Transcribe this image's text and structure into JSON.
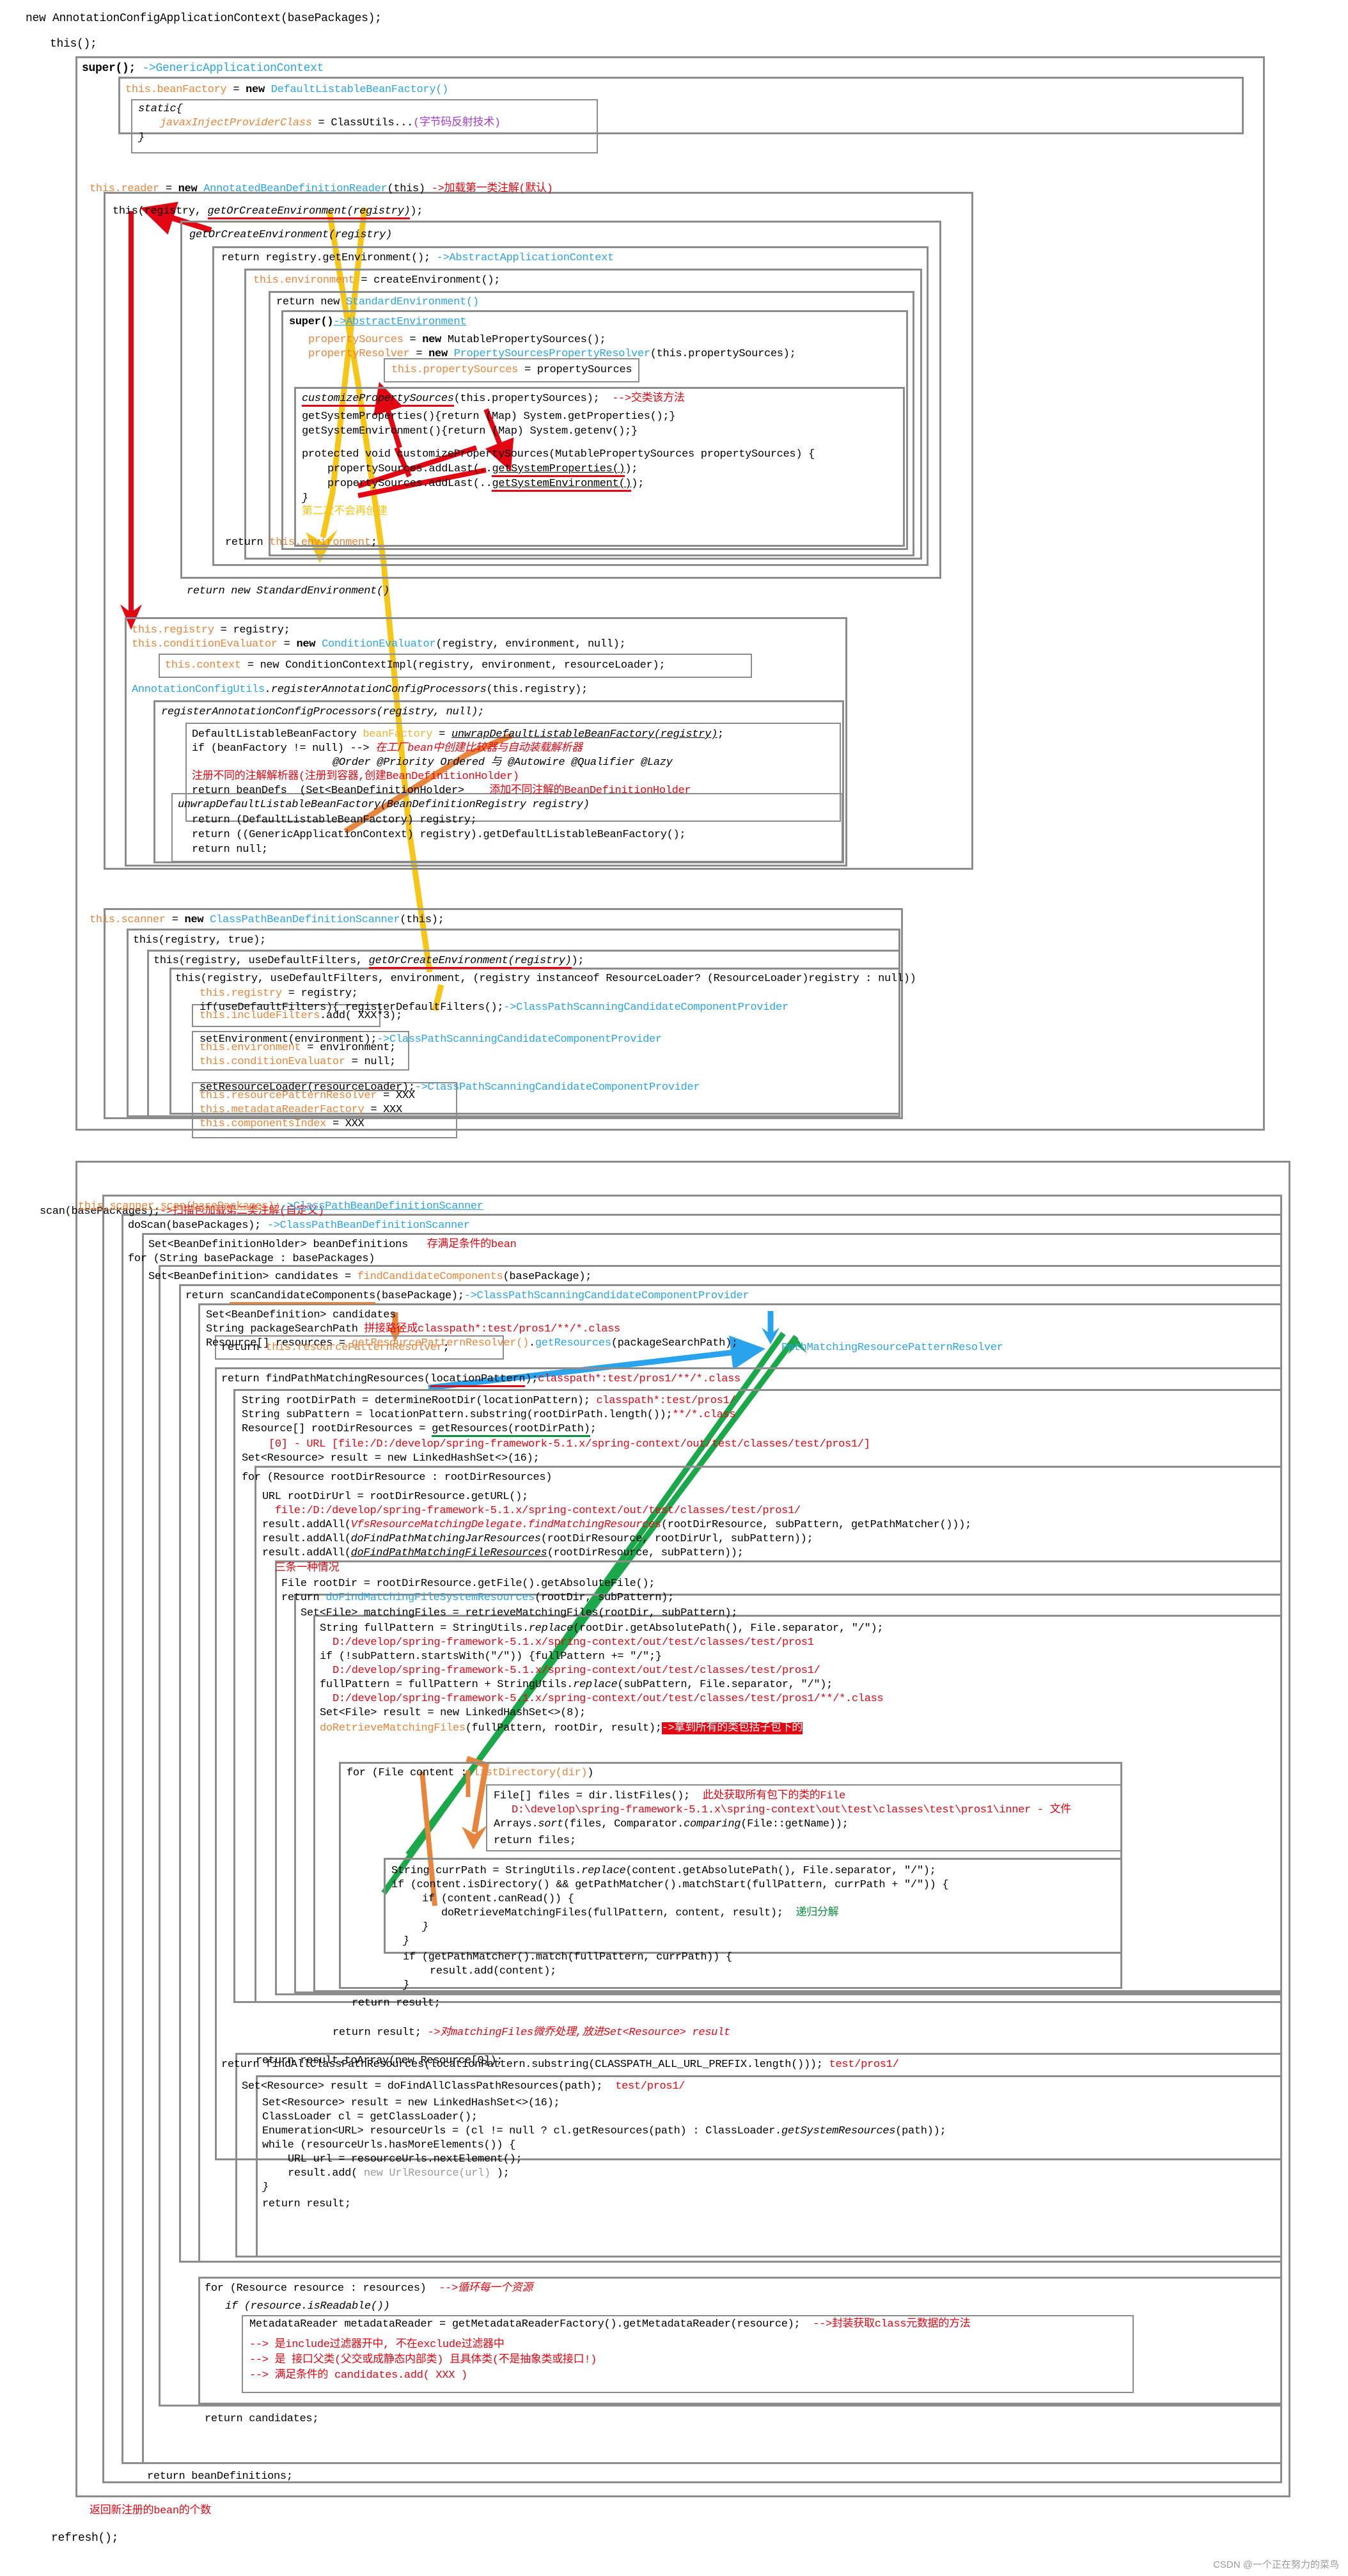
{
  "meta": {
    "watermark": "CSDN @一个正在努力的菜鸟",
    "colors": {
      "field_orange": "#e8853c",
      "type_blue": "#29a3ec",
      "comment_red": "#e30613",
      "comment_green": "#0a8f3c",
      "comment_purple": "#a23ec8",
      "box_gray": "#8c8c8c",
      "arrow_yellow": "#f5c518",
      "arrow_red": "#e30613",
      "arrow_green": "#1aa84a",
      "arrow_blue": "#29a3ec",
      "arrow_orange": "#e8853c"
    }
  },
  "lines": {
    "l001": "new AnnotationConfigApplicationContext(basePackages);",
    "l002": "this();",
    "l003_a": "super(); ",
    "l003_b": "->GenericApplicationContext",
    "l004_a": "this.beanFactory",
    "l004_b": " = ",
    "l004_c": "new",
    "l004_d": " DefaultListableBeanFactory()",
    "l005": "static{",
    "l006_a": "javaxInjectProviderClass",
    "l006_b": " = ClassUtils...",
    "l006_c": "(字节码反射技术)",
    "l007": "}",
    "l008_a": "this.reader",
    "l008_b": " = ",
    "l008_c": "new",
    "l008_d": " AnnotatedBeanDefinitionReader",
    "l008_e": "(this) ",
    "l008_f": "->加载第一类注解(默认)",
    "l009_a": "this(registry, ",
    "l009_b": "getOrCreateEnvironment(registry)",
    "l009_c": ");",
    "l010": "getOrCreateEnvironment(registry)",
    "l011_a": "return registry.getEnvironment(); ",
    "l011_b": "->AbstractApplicationContext",
    "l012_a": "this.environment",
    "l012_b": " = createEnvironment();",
    "l013_a": "return new ",
    "l013_b": "StandardEnvironment()",
    "l014_a": "super()",
    "l014_b": "->AbstractEnvironment",
    "l015_a": "propertySources",
    "l015_b": " = ",
    "l015_c": "new",
    "l015_d": " MutablePropertySources();",
    "l016_a": "propertyResolver",
    "l016_b": " = ",
    "l016_c": "new",
    "l016_d": " PropertySourcesPropertyResolver",
    "l016_e": "(this.propertySources);",
    "l017_a": "this.propertySources",
    "l017_b": " = propertySources",
    "l018_a": "customizePropertySources",
    "l018_b": "(this.propertySources);  ",
    "l018_c": "-->交类该方法",
    "l019": "getSystemProperties(){return (Map) System.getProperties();}",
    "l020": "getSystemEnvironment(){return (Map) System.getenv();}",
    "l021": "protected void customizePropertySources(MutablePropertySources propertySources) {",
    "l022_a": "propertySources.addLast(..",
    "l022_b": "getSystemProperties()",
    "l022_c": ");",
    "l023_a": "propertySources.addLast(..",
    "l023_b": "getSystemEnvironment()",
    "l023_c": ");",
    "l024": "}",
    "l025": "第二次不会再创建",
    "l026_a": "return ",
    "l026_b": "this.environment",
    "l026_c": ";",
    "l027": "return new StandardEnvironment()",
    "l028_a": "this.registry",
    "l028_b": " = registry;",
    "l029_a": "this.conditionEvaluator",
    "l029_b": " = ",
    "l029_c": "new",
    "l029_d": " ConditionEvaluator",
    "l029_e": "(registry, environment, null);",
    "l030_a": "this.context",
    "l030_b": " = new ConditionContextImpl(registry, environment, resourceLoader);",
    "l031_a": "AnnotationConfigUtils",
    "l031_b": ".registerAnnotationConfigProcessors",
    "l031_c": "(this.registry);",
    "l032": "registerAnnotationConfigProcessors(registry, null);",
    "l033_a": "DefaultListableBeanFactory ",
    "l033_b": "beanFactory",
    "l033_c": " = ",
    "l033_d": "unwrapDefaultListableBeanFactory(registry)",
    "l033_e": ";",
    "l034_a": "if (beanFactory != null) --> ",
    "l034_b": "在工厂bean中创建比较器与自动装载解析器",
    "l035": "@Order @Priority Ordered 与 @Autowire @Qualifier @Lazy",
    "l036": "注册不同的注解解析器(注册到容器,创建BeanDefinitionHolder)",
    "l037_a": "return beanDefs  (Set<BeanDefinitionHolder>    ",
    "l037_b": "添加不同注解的BeanDefinitionHolder",
    "l038": "unwrapDefaultListableBeanFactory(BeanDefinitionRegistry registry)",
    "l039": "return (DefaultListableBeanFactory) registry;",
    "l040": "return ((GenericApplicationContext) registry).getDefaultListableBeanFactory();",
    "l041": "return null;",
    "l042_a": "this.scanner",
    "l042_b": " = ",
    "l042_c": "new",
    "l042_d": " ClassPathBeanDefinitionScanner",
    "l042_e": "(this);",
    "l043": "this(registry, true);",
    "l044_a": "this(registry, useDefaultFilters, ",
    "l044_b": "getOrCreateEnvironment(registry)",
    "l044_c": ");",
    "l045_a": "this(registry, useDefaultFilters, environment, (registry instanceof ResourceLoader? (ResourceLoader)registry : null))",
    "l046_a": "this.registry",
    "l046_b": " = registry;",
    "l047_a": "if(useDefaultFilters){ registerDefaultFilters();",
    "l047_b": "->ClassPathScanningCandidateComponentProvider",
    "l048_a": "this.includeFilters",
    "l048_b": ".add( XXX*3);",
    "l049_a": "setEnvironment(environment);",
    "l049_b": "->ClassPathScanningCandidateComponentProvider",
    "l050_a": "this.environment",
    "l050_b": " = environment;",
    "l051_a": "this.conditionEvaluator",
    "l051_b": " = null;",
    "l052_a": "setResourceLoader(resourceLoader);",
    "l052_b": "->ClassPathScanningCandidateComponentProvider",
    "l053_a": "this.resourcePatternResolver",
    "l053_b": " = XXX",
    "l054_a": "this.metadataReaderFactory",
    "l054_b": " = XXX",
    "l055_a": "this.componentsIndex",
    "l055_b": " = XXX",
    "l056_a": "scan(basePackages);",
    "l056_b": "->扫描包加载第二类注解(自定义)",
    "l057_a": "this.scanner.scan(basePackages);",
    "l057_b": "->ClassPathBeanDefinitionScanner",
    "l058_a": "doScan(basePackages); ",
    "l058_b": "->ClassPathBeanDefinitionScanner",
    "l059_a": "Set<BeanDefinitionHolder> beanDefinitions   ",
    "l059_b": "存满足条件的bean",
    "l060": "for (String basePackage : basePackages)",
    "l061_a": "Set<BeanDefinition> candidates = ",
    "l061_b": "findCandidateComponents",
    "l061_c": "(basePackage);",
    "l062_a": "return ",
    "l062_b": "scanCandidateComponents",
    "l062_c": "(basePackage);",
    "l062_d": "->ClassPathScanningCandidateComponentProvider",
    "l063": "Set<BeanDefinition> candidates",
    "l064_a": "String packageSearchPath ",
    "l064_b": "拼接路径成classpath*:test/pros1/**/*.class",
    "l065_a": "Resource[] resources = ",
    "l065_b": "getResourcePatternResolver()",
    "l065_c": ".",
    "l065_d": "getResources",
    "l065_e": "(packageSearchPath);",
    "l066_a": "return ",
    "l066_b": "this.resourcePatternResolver",
    "l066_c": ";",
    "l067": "PathMatchingResourcePatternResolver",
    "l068_a": "return findPathMatchingResources(",
    "l068_b": "locationPattern",
    "l068_c": ");",
    "l068_d": "classpath*:test/pros1/**/*.class",
    "l069_a": "String rootDirPath = determineRootDir(locationPattern); ",
    "l069_b": "classpath*:test/pros1/",
    "l070_a": "String subPattern = locationPattern.substring(rootDirPath.length());",
    "l070_b": "**/*.class",
    "l071_a": "Resource[] rootDirResources = ",
    "l071_b": "getResources(rootDirPath)",
    "l071_c": ";",
    "l072": "[0] - URL [file:/D:/develop/spring-framework-5.1.x/spring-context/out/test/classes/test/pros1/]",
    "l073": "Set<Resource> result = new LinkedHashSet<>(16);",
    "l074_a": "for (Resource rootDirResource : rootDirResources)",
    "l075": "URL rootDirUrl = rootDirResource.getURL();",
    "l076": "file:/D:/develop/spring-framework-5.1.x/spring-context/out/test/classes/test/pros1/",
    "l077_a": "result.addAll(",
    "l077_b": "VfsResourceMatchingDelegate.findMatchingResources",
    "l077_c": "(rootDirResource, subPattern, getPathMatcher()));",
    "l078_a": "result.addAll(",
    "l078_b": "doFindPathMatchingJarResources",
    "l078_c": "(rootDirResource, rootDirUrl, subPattern));",
    "l079_a": "result.addAll(",
    "l079_b": "doFindPathMatchingFileResources",
    "l079_c": "(rootDirResource, subPattern));",
    "l080": "三条一种情况",
    "l081": "File rootDir = rootDirResource.getFile().getAbsoluteFile();",
    "l082_a": "return ",
    "l082_b": "doFindMatchingFileSystemResources",
    "l082_c": "(rootDir, subPattern);",
    "l083": "Set<File> matchingFiles = retrieveMatchingFiles(rootDir, subPattern);",
    "l084_a": "String fullPattern = StringUtils.",
    "l084_b": "replace",
    "l084_c": "(rootDir.getAbsolutePath(), File.separator, \"/\");",
    "l085": "D:/develop/spring-framework-5.1.x/spring-context/out/test/classes/test/pros1",
    "l086_a": "if (!subPattern.startsWith(\"/\")) {fullPattern += \"/\";}",
    "l087": "D:/develop/spring-framework-5.1.x/spring-context/out/test/classes/test/pros1/",
    "l088_a": "fullPattern = fullPattern + StringUtils.",
    "l088_b": "replace",
    "l088_c": "(subPattern, File.separator, \"/\");",
    "l089": "D:/develop/spring-framework-5.1.x/spring-context/out/test/classes/test/pros1/**/*.class",
    "l090": "Set<File> result = new LinkedHashSet<>(8);",
    "l091_a": "doRetrieveMatchingFiles",
    "l091_b": "(fullPattern, rootDir, result);",
    "l091_c": "->拿到所有的类包括子包下的",
    "l092_a": "for (File content : ",
    "l092_b": "listDirectory(dir)",
    "l092_c": ")",
    "l093_a": "File[] files = dir.listFiles();  ",
    "l093_b": "此处获取所有包下的类的File",
    "l094": "D:\\develop\\spring-framework-5.1.x\\spring-context\\out\\test\\classes\\test\\pros1\\inner - 文件",
    "l095_a": "Arrays.",
    "l095_b": "sort",
    "l095_c": "(files, Comparator.",
    "l095_d": "comparing",
    "l095_e": "(File::getName));",
    "l096": "return files;",
    "l097_a": "String currPath = StringUtils.",
    "l097_b": "replace",
    "l097_c": "(content.getAbsolutePath(), File.separator, \"/\");",
    "l098": "if (content.isDirectory() && getPathMatcher().matchStart(fullPattern, currPath + \"/\")) {",
    "l099": "if (content.canRead()) {",
    "l100_a": "doRetrieveMatchingFiles(fullPattern, content, result);  ",
    "l100_b": "递归分解",
    "l101": "}",
    "l102": "}",
    "l103": "if (getPathMatcher().match(fullPattern, currPath)) {",
    "l104": "result.add(content);",
    "l105": "}",
    "l106": "return result;",
    "l107_a": "return result; ",
    "l107_b": "->对matchingFiles微乔处理,放进Set<Resource> result",
    "l108": "return result.toArray(new Resource[0]);",
    "l109_a": "return findAllClassPathResources(locationPattern.substring(CLASSPATH_ALL_URL_PREFIX.length())); ",
    "l109_b": "test/pros1/",
    "l110_a": "Set<Resource> result = doFindAllClassPathResources(path);  ",
    "l110_b": "test/pros1/",
    "l111": "Set<Resource> result = new LinkedHashSet<>(16);",
    "l112": "ClassLoader cl = getClassLoader();",
    "l113_a": "Enumeration<URL> resourceUrls = (cl != null ? cl.getResources(path) : ClassLoader.",
    "l113_b": "getSystemResources",
    "l113_c": "(path));",
    "l114": "while (resourceUrls.hasMoreElements()) {",
    "l115": "URL url = resourceUrls.nextElement();",
    "l116_a": "result.add( ",
    "l116_b": "new UrlResource(url)",
    "l116_c": " );",
    "l117": "}",
    "l118": "return result;",
    "l119_a": "for (Resource resource : resources)  ",
    "l119_b": "-->循环每一个资源",
    "l120": "if (resource.isReadable())",
    "l121_a": "MetadataReader metadataReader = getMetadataReaderFactory().getMetadataReader(resource);  ",
    "l121_b": "-->封装获取class元数据的方法",
    "l122": "--> 是include过滤器开中, 不在exclude过滤器中",
    "l123": "--> 是 接口父类(父交或成静态内部类) 且具体类(不是抽象类或接口!)",
    "l124": "--> 满足条件的 candidates.add( XXX )",
    "l125": "return candidates;",
    "l126": "return beanDefinitions;",
    "l127": "返回新注册的bean的个数",
    "l128": "refresh();"
  }
}
